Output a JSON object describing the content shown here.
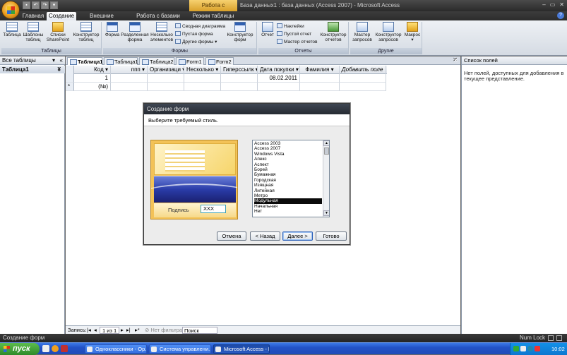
{
  "titlebar": {
    "context_tab": "Работа с таблицами",
    "title": "База данных1 : база данных (Access 2007) - Microsoft Access"
  },
  "ribbon_tabs": [
    "Главная",
    "Создание",
    "Внешние данные",
    "Работа с базами данных",
    "Режим таблицы"
  ],
  "ribbon": {
    "tables": {
      "label": "Таблицы",
      "btn_table": "Таблица",
      "btn_templates_1": "Шаблоны",
      "btn_templates_2": "таблиц",
      "btn_sharepoint_1": "Списки",
      "btn_sharepoint_2": "SharePoint",
      "btn_designer_1": "Конструктор",
      "btn_designer_2": "таблиц"
    },
    "forms": {
      "label": "Формы",
      "btn_form": "Форма",
      "btn_split_1": "Разделенная",
      "btn_split_2": "форма",
      "btn_multi_1": "Несколько",
      "btn_multi_2": "элементов",
      "btn_pivot": "Сводная диаграмма",
      "btn_blank": "Пустая форма",
      "btn_more": "Другие формы",
      "btn_designer_1": "Конструктор",
      "btn_designer_2": "форм"
    },
    "reports": {
      "label": "Отчеты",
      "btn_report": "Отчет",
      "btn_labels": "Наклейки",
      "btn_blank": "Пустой отчет",
      "btn_wizard": "Мастер отчетов",
      "btn_designer_1": "Конструктор",
      "btn_designer_2": "отчетов"
    },
    "other": {
      "label": "Другие",
      "btn_query_wizard_1": "Мастер",
      "btn_query_wizard_2": "запросов",
      "btn_query_designer_1": "Конструктор",
      "btn_query_designer_2": "запросов",
      "btn_macro": "Макрос"
    }
  },
  "navpane": {
    "header": "Все таблицы",
    "group": "Таблица1"
  },
  "doc_tabs": [
    "Таблица1",
    "Таблица1",
    "Таблица2",
    "Form1",
    "Form2"
  ],
  "table": {
    "columns": [
      "Код",
      "ппп",
      "Организаци",
      "Несколько",
      "Гиперссылк",
      "Дата покупки",
      "Фамилия",
      "Добавить поле"
    ],
    "rows": [
      {
        "marker": "",
        "values": [
          "1",
          "",
          "",
          "",
          "",
          "08.02.2011",
          "",
          ""
        ]
      },
      {
        "marker": "*",
        "values": [
          "(№)",
          "",
          "",
          "",
          "",
          "",
          "",
          ""
        ]
      }
    ]
  },
  "record_nav": {
    "label": "Запись:",
    "position": "1 из 1",
    "filter": "Нет фильтра",
    "search": "Поиск"
  },
  "field_list": {
    "header": "Список полей",
    "message": "Нет полей, доступных для добавления в текущее представление."
  },
  "dialog": {
    "title": "Создание форм",
    "subtitle": "Выберите требуемый стиль.",
    "preview_label": "Подпись",
    "preview_value": "XXX",
    "styles": [
      "Access 2003",
      "Access 2007",
      "Windows Vista",
      "Апекс",
      "Аспект",
      "Борей",
      "Бумажная",
      "Городская",
      "Изящная",
      "Литейная",
      "Метро",
      "Модульная",
      "Начальная",
      "Нет"
    ],
    "selected_style": "Модульная",
    "buttons": {
      "cancel": "Отмена",
      "back": "< Назад",
      "next": "Далее >",
      "finish": "Готово"
    }
  },
  "statusbar": {
    "left": "Создание форм",
    "right": "Num Lock"
  },
  "taskbar": {
    "start": "пуск",
    "items": [
      "Одноклассники - Ор...",
      "Система управлени...",
      "Microsoft Access - Ба..."
    ],
    "time": "10:02"
  }
}
